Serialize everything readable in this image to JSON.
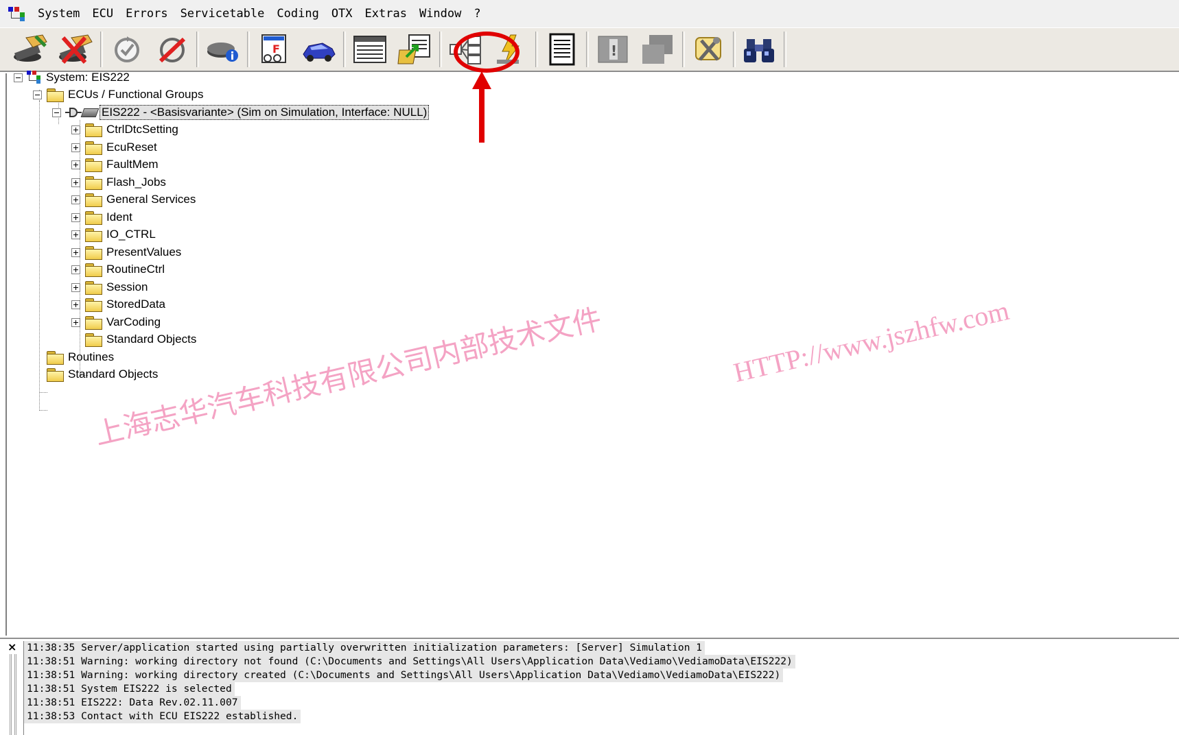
{
  "menubar": {
    "items": [
      "System",
      "ECU",
      "Errors",
      "Servicetable",
      "Coding",
      "OTX",
      "Extras",
      "Window",
      "?"
    ]
  },
  "toolbar": {
    "buttons": [
      {
        "icon": "connect-icon"
      },
      {
        "icon": "disconnect-icon"
      },
      {
        "icon": "refresh-icon"
      },
      {
        "icon": "no-refresh-icon"
      },
      {
        "icon": "ecu-info-icon"
      },
      {
        "icon": "flash-report-icon"
      },
      {
        "icon": "vehicle-icon"
      },
      {
        "icon": "table-view-icon"
      },
      {
        "icon": "export-icon"
      },
      {
        "icon": "functional-group-icon",
        "highlighted": true
      },
      {
        "icon": "lightning-icon"
      },
      {
        "icon": "document-icon"
      },
      {
        "icon": "exclamation-icon"
      },
      {
        "icon": "gray-panel-icon"
      },
      {
        "icon": "tools-icon"
      },
      {
        "icon": "binoculars-icon"
      }
    ]
  },
  "tree": {
    "root": "System: EIS222",
    "ecus_group": "ECUs / Functional Groups",
    "ecu": "EIS222 - <Basisvariante> (Sim on Simulation, Interface: NULL)",
    "ecu_children": [
      "CtrlDtcSetting",
      "EcuReset",
      "FaultMem",
      "Flash_Jobs",
      "General Services",
      "Ident",
      "IO_CTRL",
      "PresentValues",
      "RoutineCtrl",
      "Session",
      "StoredData",
      "VarCoding"
    ],
    "ecu_leaf": "Standard Objects",
    "routines": "Routines",
    "standard_objects": "Standard Objects"
  },
  "log": {
    "close_label": "×",
    "lines": [
      "11:38:35 Server/application started using partially overwritten initialization parameters: [Server] Simulation 1",
      "11:38:51 Warning: working directory not found (C:\\Documents and Settings\\All Users\\Application Data\\Vediamo\\VediamoData\\EIS222)",
      "11:38:51 Warning: working directory created (C:\\Documents and Settings\\All Users\\Application Data\\Vediamo\\VediamoData\\EIS222)",
      "11:38:51 System EIS222 is selected",
      "11:38:51 EIS222: Data Rev.02.11.007",
      "11:38:53 Contact with ECU EIS222 established."
    ]
  },
  "watermark": {
    "chinese": "上海志华汽车科技有限公司内部技术文件",
    "url": "HTTP://www.jszhfw.com"
  },
  "colors": {
    "annotation": "#e00000",
    "watermark": "#f4a3c4",
    "toolbar_bg": "#ece9e3"
  }
}
